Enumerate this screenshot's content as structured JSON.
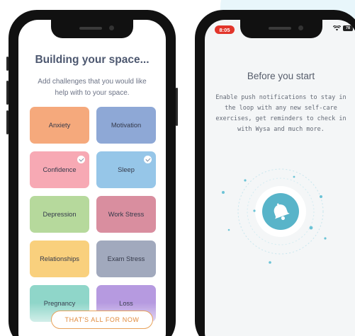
{
  "colors": {
    "accent_orange": "#e8a25a",
    "teal": "#58b4c9",
    "status_red": "#e2352b"
  },
  "screen1": {
    "title": "Building your space...",
    "subtitle": "Add challenges that you would like help with to your space.",
    "challenges": [
      {
        "label": "Anxiety",
        "selected": false,
        "color": "#f5a97c"
      },
      {
        "label": "Motivation",
        "selected": false,
        "color": "#8ea8d6"
      },
      {
        "label": "Confidence",
        "selected": true,
        "color": "#f7a9b4"
      },
      {
        "label": "Sleep",
        "selected": true,
        "color": "#96c6e8"
      },
      {
        "label": "Depression",
        "selected": false,
        "color": "#b6d99c"
      },
      {
        "label": "Work Stress",
        "selected": false,
        "color": "#d98e9f"
      },
      {
        "label": "Relationships",
        "selected": false,
        "color": "#f9d07d"
      },
      {
        "label": "Exam Stress",
        "selected": false,
        "color": "#a1a9bd"
      },
      {
        "label": "Pregnancy",
        "selected": false,
        "color": "#8fd6c9"
      },
      {
        "label": "Loss",
        "selected": false,
        "color": "#b69ae0"
      }
    ],
    "cta_label": "THAT'S ALL FOR NOW"
  },
  "screen2": {
    "status_time": "8:05",
    "battery": "78",
    "title": "Before you start",
    "body": "Enable push notifications to stay in the loop with any new self-care exercises, get reminders to check in with Wysa and much more."
  }
}
